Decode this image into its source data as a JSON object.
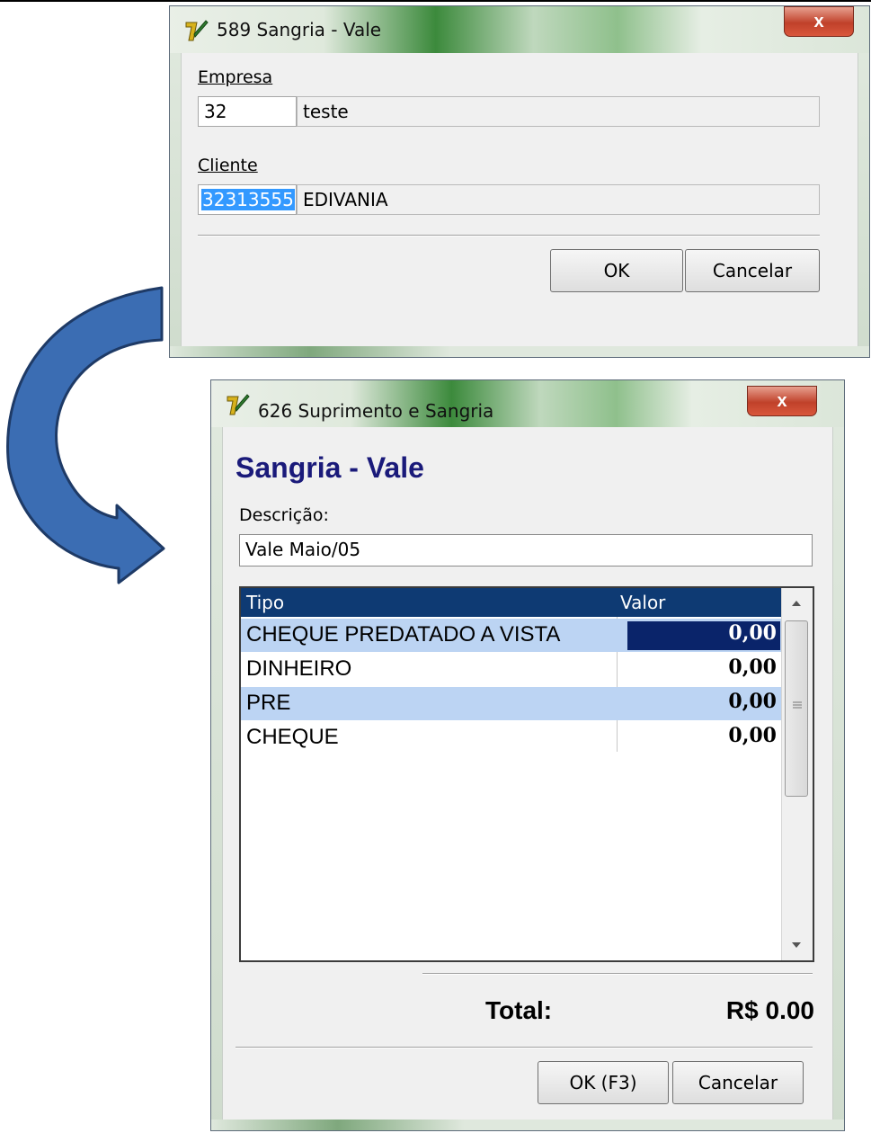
{
  "window1": {
    "title": "589 Sangria - Vale",
    "close_glyph": "x",
    "empresa_label": "Empresa",
    "empresa_code": "32",
    "empresa_name": "teste",
    "cliente_label": "Cliente",
    "cliente_code": "32313555",
    "cliente_name": "EDIVANIA",
    "ok_label": "OK",
    "cancel_label": "Cancelar"
  },
  "window2": {
    "title": "626 Suprimento e Sangria",
    "close_glyph": "x",
    "heading": "Sangria - Vale",
    "descricao_label": "Descrição:",
    "descricao_value": "Vale Maio/05",
    "grid": {
      "headers": [
        "Tipo",
        "Valor"
      ],
      "rows": [
        {
          "tipo": "CHEQUE PREDATADO A VISTA",
          "valor": "0,00"
        },
        {
          "tipo": "DINHEIRO",
          "valor": "0,00"
        },
        {
          "tipo": "PRE",
          "valor": "0,00"
        },
        {
          "tipo": "CHEQUE",
          "valor": "0,00"
        }
      ]
    },
    "total_label": "Total:",
    "total_value": "R$ 0.00",
    "ok_label": "OK (F3)",
    "cancel_label": "Cancelar"
  },
  "colors": {
    "heading": "#1a1a7a",
    "grid_header": "#0e3a73",
    "row_highlight": "#bcd4f3",
    "cell_selected": "#0a246a",
    "arrow_fill": "#3b6db3",
    "arrow_stroke": "#1e3a66"
  }
}
